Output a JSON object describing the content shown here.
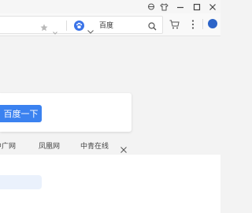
{
  "address_bar": {
    "search_engine": "百度"
  },
  "search_box": {
    "button_label": "百度一下"
  },
  "shortcuts": [
    "中广网",
    "凤凰网",
    "中青在线"
  ],
  "colors": {
    "accent": "#3b82f0",
    "engine_icon": "#3a73e8",
    "background": "#f3f3f3"
  },
  "icons": {
    "titlebar": [
      "mirror-icon",
      "shirt-icon",
      "minimize-icon",
      "maximize-icon",
      "close-window-icon"
    ],
    "address_bar": [
      "star-icon",
      "chevron-down-icon",
      "baidu-paw-icon",
      "search-icon"
    ],
    "toolbar": [
      "cart-icon",
      "more-menu-icon",
      "avatar"
    ],
    "shortcuts_bar": [
      "close-icon"
    ]
  }
}
